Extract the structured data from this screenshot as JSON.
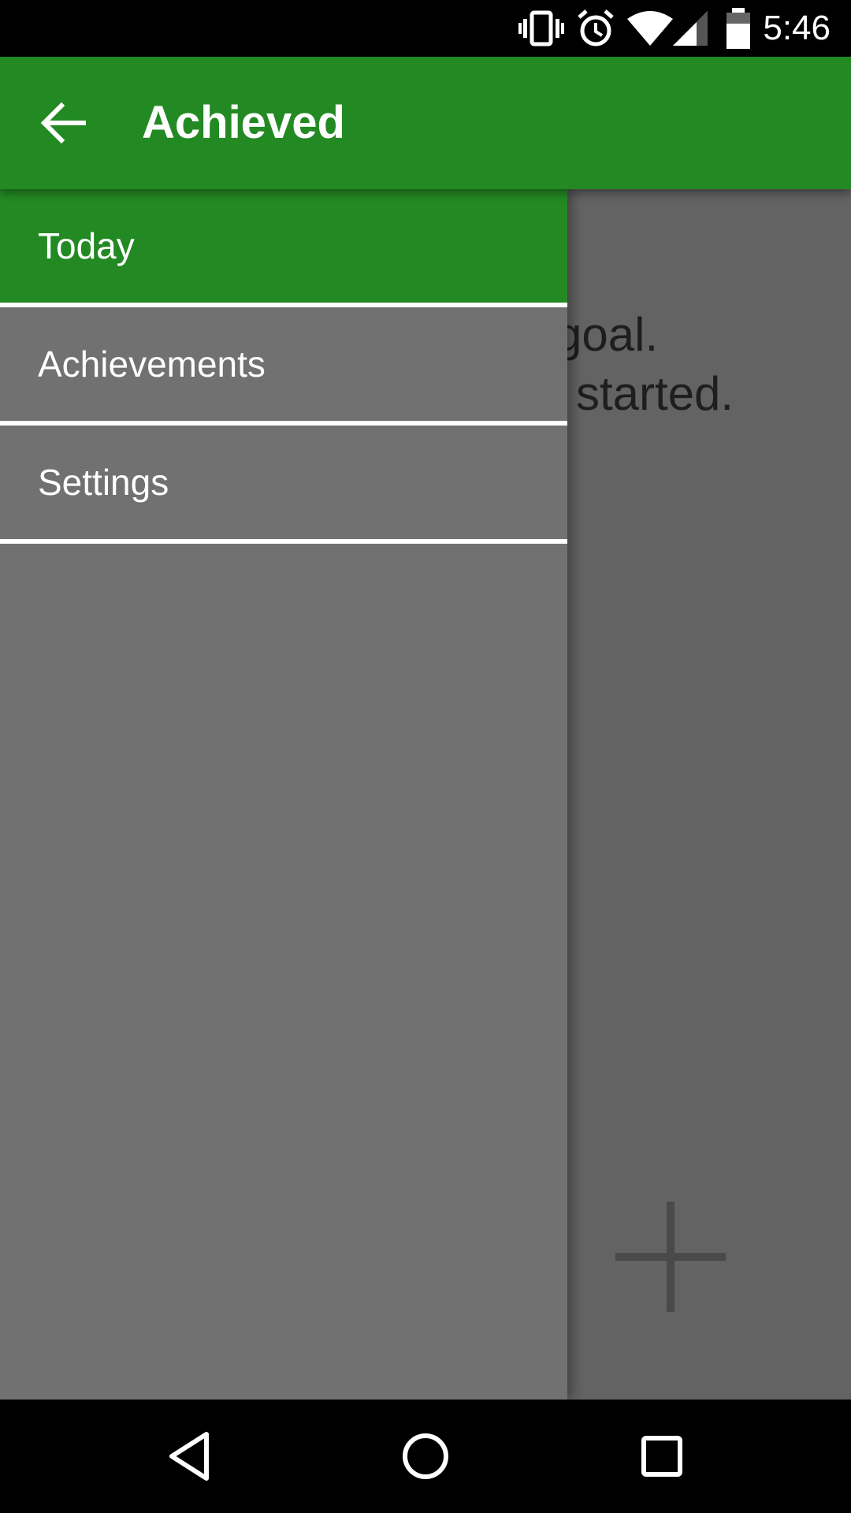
{
  "status_bar": {
    "time": "5:46",
    "icons": [
      "vibrate-icon",
      "alarm-icon",
      "wifi-icon",
      "signal-icon",
      "battery-icon"
    ]
  },
  "app_bar": {
    "title": "Achieved",
    "back_icon": "arrow-left-icon",
    "color": "#238a23"
  },
  "drawer": {
    "items": [
      {
        "label": "Today",
        "selected": true
      },
      {
        "label": "Achievements",
        "selected": false
      },
      {
        "label": "Settings",
        "selected": false
      }
    ],
    "selected_color": "#238a23"
  },
  "content": {
    "line_1": "goal.",
    "line_2": "started.",
    "fab_icon": "plus-icon"
  },
  "nav_bar": {
    "icons": [
      "back-triangle-icon",
      "home-circle-icon",
      "recents-square-icon"
    ]
  }
}
